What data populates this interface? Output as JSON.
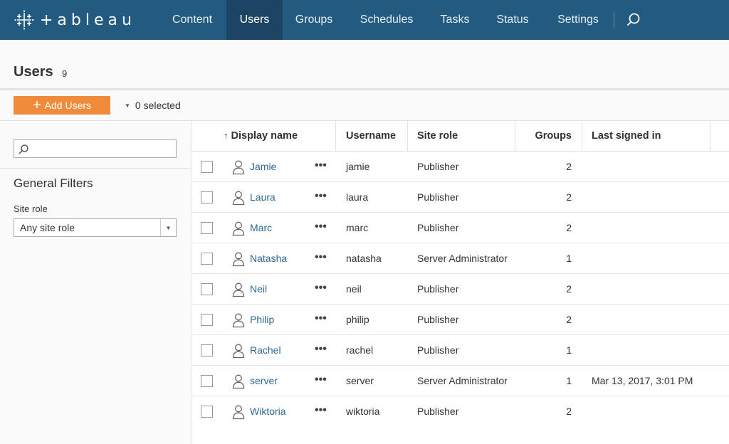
{
  "brand": {
    "logo_text": "+ableau"
  },
  "nav": {
    "items": [
      {
        "label": "Content",
        "active": false
      },
      {
        "label": "Users",
        "active": true
      },
      {
        "label": "Groups",
        "active": false
      },
      {
        "label": "Schedules",
        "active": false
      },
      {
        "label": "Tasks",
        "active": false
      },
      {
        "label": "Status",
        "active": false
      },
      {
        "label": "Settings",
        "active": false
      }
    ],
    "search_icon": "search-icon"
  },
  "page": {
    "title": "Users",
    "count": "9"
  },
  "actions": {
    "add_label": "Add Users",
    "selected_label": "0 selected"
  },
  "sidebar": {
    "search_placeholder": "",
    "filters_title": "General Filters",
    "site_role_label": "Site role",
    "site_role_value": "Any site role"
  },
  "table": {
    "columns": {
      "sort_arrow": "↑",
      "display_name": "Display name",
      "username": "Username",
      "site_role": "Site role",
      "groups": "Groups",
      "last_signed_in": "Last signed in"
    },
    "more_label": "•••",
    "rows": [
      {
        "display_name": "Jamie",
        "username": "jamie",
        "site_role": "Publisher",
        "groups": "2",
        "last_signed_in": ""
      },
      {
        "display_name": "Laura",
        "username": "laura",
        "site_role": "Publisher",
        "groups": "2",
        "last_signed_in": ""
      },
      {
        "display_name": "Marc",
        "username": "marc",
        "site_role": "Publisher",
        "groups": "2",
        "last_signed_in": ""
      },
      {
        "display_name": "Natasha",
        "username": "natasha",
        "site_role": "Server Administrator",
        "groups": "1",
        "last_signed_in": ""
      },
      {
        "display_name": "Neil",
        "username": "neil",
        "site_role": "Publisher",
        "groups": "2",
        "last_signed_in": ""
      },
      {
        "display_name": "Philip",
        "username": "philip",
        "site_role": "Publisher",
        "groups": "2",
        "last_signed_in": ""
      },
      {
        "display_name": "Rachel",
        "username": "rachel",
        "site_role": "Publisher",
        "groups": "1",
        "last_signed_in": ""
      },
      {
        "display_name": "server",
        "username": "server",
        "site_role": "Server Administrator",
        "groups": "1",
        "last_signed_in": "Mar 13, 2017, 3:01 PM"
      },
      {
        "display_name": "Wiktoria",
        "username": "wiktoria",
        "site_role": "Publisher",
        "groups": "2",
        "last_signed_in": ""
      }
    ]
  },
  "colors": {
    "nav_bg": "#235a7f",
    "nav_active": "#1b4563",
    "accent_orange": "#ef8b3a",
    "link_blue": "#2c6892"
  }
}
